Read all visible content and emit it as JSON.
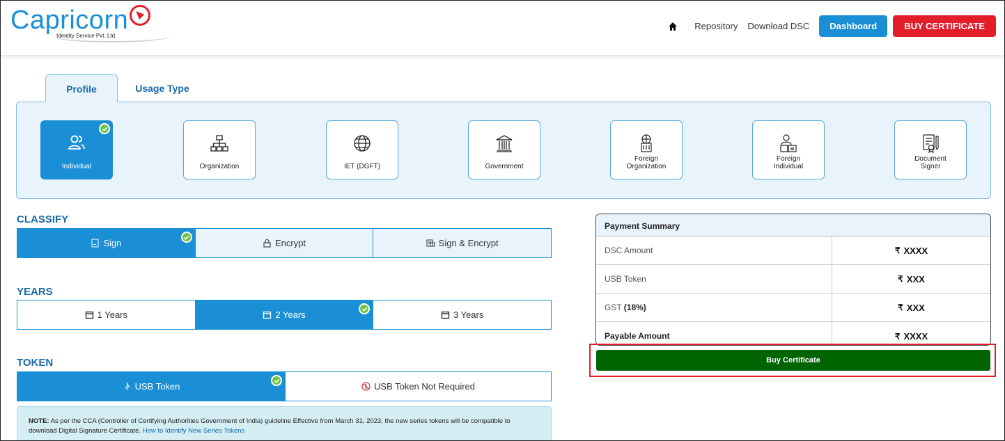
{
  "header": {
    "logo_text": "Capricorn",
    "logo_subtext": "Identity Service Pvt. Ltd.",
    "nav": {
      "repository": "Repository",
      "download_dsc": "Download DSC",
      "dashboard": "Dashboard",
      "buy_certificate": "BUY CERTIFICATE"
    }
  },
  "tabs": [
    {
      "label": "Profile",
      "active": true
    },
    {
      "label": "Usage Type",
      "active": false
    }
  ],
  "profiles": [
    {
      "label": "Individual",
      "icon": "users-icon",
      "selected": true
    },
    {
      "label": "Organization",
      "icon": "org-chart-icon",
      "selected": false
    },
    {
      "label": "IET (DGFT)",
      "icon": "globe-icon",
      "selected": false
    },
    {
      "label": "Government",
      "icon": "government-building-icon",
      "selected": false
    },
    {
      "label": "Foreign Organization",
      "icon": "foreign-organization-icon",
      "selected": false
    },
    {
      "label": "Foreign Individual",
      "icon": "foreign-individual-icon",
      "selected": false
    },
    {
      "label": "Document Signer",
      "icon": "document-signer-icon",
      "selected": false
    }
  ],
  "classify": {
    "title": "CLASSIFY",
    "options": [
      {
        "label": "Sign",
        "icon": "sign-icon",
        "selected": true
      },
      {
        "label": "Encrypt",
        "icon": "lock-icon",
        "selected": false
      },
      {
        "label": "Sign & Encrypt",
        "icon": "sign-encrypt-icon",
        "selected": false
      }
    ]
  },
  "years": {
    "title": "YEARS",
    "options": [
      {
        "label": "1 Years",
        "selected": false
      },
      {
        "label": "2 Years",
        "selected": true
      },
      {
        "label": "3 Years",
        "selected": false
      }
    ]
  },
  "token": {
    "title": "TOKEN",
    "options": [
      {
        "label": "USB Token",
        "selected": true
      },
      {
        "label": "USB Token Not Required",
        "selected": false
      }
    ]
  },
  "note": {
    "label": "NOTE:",
    "text": "As per the CCA (Controller of Certifying Authorities Government of India) guideline Effective from March 31, 2023, the new series tokens will be compatible to download Digital Signature Certificate.",
    "link": "How to Identify New Series Tokens"
  },
  "payment": {
    "title": "Payment Summary",
    "currency": "₹",
    "rows": [
      {
        "label": "DSC Amount",
        "value": "XXXX"
      },
      {
        "label": "USB Token",
        "value": "XXX"
      },
      {
        "label": "GST",
        "extra": "(18%)",
        "value": "XXX"
      },
      {
        "label": "Payable Amount",
        "value": "XXXX"
      }
    ],
    "button": "Buy Certificate"
  },
  "colors": {
    "primary": "#1a8fd6",
    "danger": "#e31e2b",
    "success": "#006400",
    "check": "#6fc24a"
  }
}
